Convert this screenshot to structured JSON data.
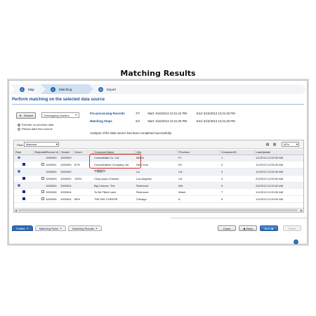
{
  "page_title": "Matching Results",
  "wizard": {
    "steps": [
      {
        "label": "Map",
        "active": false
      },
      {
        "label": "Matching",
        "active": true
      },
      {
        "label": "Export",
        "active": false
      }
    ]
  },
  "section_title": "Perform matching on the selected data source",
  "controls": {
    "restart_label": "Restart",
    "algorithm_value": "Overlapping clusters",
    "radio_previous": "Execute on previous data",
    "radio_reload": "Reload data from source"
  },
  "stats": [
    {
      "label": "Pre-processing Records",
      "count": "7/7",
      "start": "Start: 6/16/2013 12:21:24 PM",
      "end": "End: 6/16/2013 12:21:25 PM"
    },
    {
      "label": "Matching Steps",
      "count": "2/2",
      "start": "Start: 6/16/2013 12:21:25 PM",
      "end": "End: 6/16/2013 12:21:25 PM"
    }
  ],
  "analysis_note": "Analysis of the data source has been completed successfully.",
  "filter": {
    "label": "Filter:",
    "value": "Matched"
  },
  "zoom": "80%",
  "grid": {
    "columns": [
      "Rule",
      "Rejected",
      "Record Id",
      "Cluster",
      "Score",
      "CustomerName",
      "City",
      "Province",
      "CustomerID",
      "LastUpdate"
    ],
    "rows": [
      {
        "kind": "group",
        "record_id": "1000000",
        "cluster": "1000000",
        "score": "",
        "name": "Consolidate Co. Ltd",
        "city": "Miami",
        "province": "FL",
        "cust_id": "1",
        "updated": "1/1/2013 12:00:00 AM"
      },
      {
        "kind": "child",
        "record_id": "1000001",
        "cluster": "1000000",
        "score": "87%",
        "name": "Consolidation Company Ltd",
        "city": "New York",
        "province": "NY",
        "cust_id": "2",
        "updated": "1/1/2013 12:00:00 AM"
      },
      {
        "kind": "group",
        "record_id": "1000002",
        "cluster": "1000002",
        "score": "",
        "name": "中國超市",
        "city": "LA",
        "province": "CA",
        "cust_id": "3",
        "updated": "1/1/2013 12:00:00 AM"
      },
      {
        "kind": "child",
        "record_id": "1000003",
        "cluster": "1000002",
        "score": "100%",
        "name": "Chop-suey Chinese",
        "city": "Los Angeles",
        "province": "CA",
        "cust_id": "4",
        "updated": "2/2/2013 12:00:00 AM"
      },
      {
        "kind": "group",
        "record_id": "1000004",
        "cluster": "1000004",
        "score": "",
        "name": "Big Cheese, The",
        "city": "Redmond",
        "province": "WA",
        "cust_id": "5",
        "updated": "2/2/2013 12:00:00 AM"
      },
      {
        "kind": "child",
        "record_id": "1000006",
        "cluster": "1000004",
        "score": "",
        "name": "To Be Filled Later",
        "city": "Redmond",
        "province": "Wash.",
        "cust_id": "7",
        "updated": "1/1/2013 12:00:00 AM"
      },
      {
        "kind": "child",
        "record_id": "1000005",
        "cluster": "1000004",
        "score": "88%",
        "name": "THE BIG CHEESE",
        "city": "Chicago",
        "province": "IL",
        "cust_id": "6",
        "updated": "1/1/2013 12:00:00 AM"
      }
    ]
  },
  "bottom_tabs": [
    {
      "label": "Profiler",
      "active": true
    },
    {
      "label": "Matching Rules",
      "active": false
    },
    {
      "label": "Matching Results",
      "active": false
    }
  ],
  "nav": {
    "close": "Close",
    "back": "Back",
    "next": "Next",
    "finish": "Finish"
  },
  "colors": {
    "accent": "#2c6fb4",
    "title_blue": "#1c4f96",
    "highlight": "#d32f2f"
  }
}
